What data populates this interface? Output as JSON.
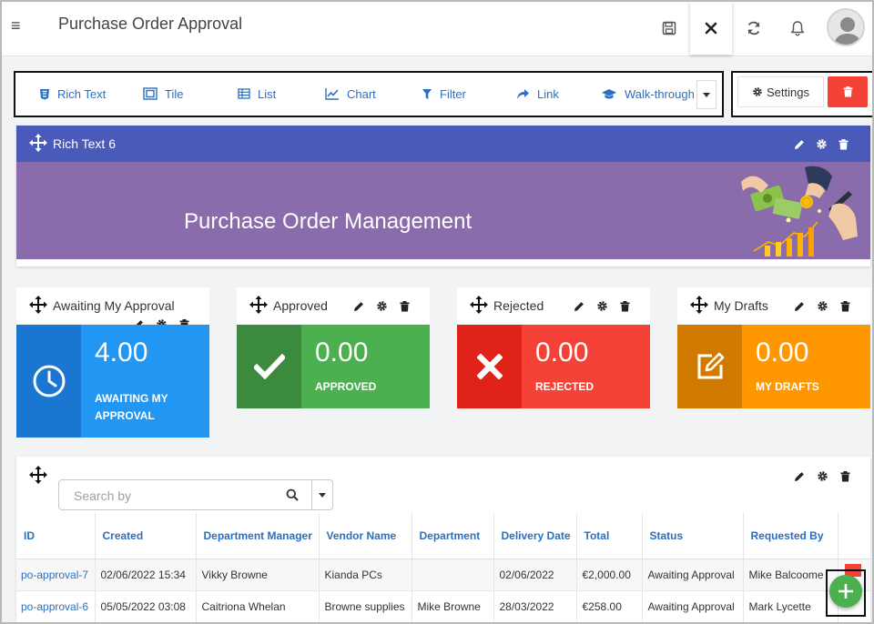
{
  "header": {
    "title": "Purchase Order Approval",
    "icons": [
      "menu-icon",
      "save-icon",
      "close-icon",
      "refresh-icon",
      "bell-icon",
      "user-avatar"
    ]
  },
  "toolbar": {
    "items": [
      {
        "label": "Rich Text",
        "icon": "rich-text-icon"
      },
      {
        "label": "Tile",
        "icon": "tile-icon"
      },
      {
        "label": "List",
        "icon": "list-icon"
      },
      {
        "label": "Chart",
        "icon": "chart-icon"
      },
      {
        "label": "Filter",
        "icon": "filter-icon"
      },
      {
        "label": "Link",
        "icon": "link-icon"
      },
      {
        "label": "Walk-through",
        "icon": "graduation-cap-icon"
      }
    ],
    "settings_label": "Settings"
  },
  "rich_text": {
    "widget_title": "Rich Text 6",
    "heading": "Purchase Order Management"
  },
  "cards": [
    {
      "title": "Awaiting My Approval",
      "value": "4.00",
      "caption_line1": "AWAITING MY",
      "caption_line2": "APPROVAL",
      "color": "#2196f3",
      "icon_bg": "#1b76d2",
      "icon": "clock-icon"
    },
    {
      "title": "Approved",
      "value": "0.00",
      "caption_line1": "APPROVED",
      "caption_line2": "",
      "color": "#4caf50",
      "icon_bg": "#3b8a3e",
      "icon": "check-icon"
    },
    {
      "title": "Rejected",
      "value": "0.00",
      "caption_line1": "REJECTED",
      "caption_line2": "",
      "color": "#f44336",
      "icon_bg": "#e02318",
      "icon": "x-icon"
    },
    {
      "title": "My Drafts",
      "value": "0.00",
      "caption_line1": "MY DRAFTS",
      "caption_line2": "",
      "color": "#ff9800",
      "icon_bg": "#d17a00",
      "icon": "edit-icon"
    }
  ],
  "table": {
    "search_placeholder": "Search by",
    "columns": [
      "ID",
      "Created",
      "Department Manager",
      "Vendor Name",
      "Department",
      "Delivery Date",
      "Total",
      "Status",
      "Requested By"
    ],
    "rows": [
      [
        "po-approval-7",
        "02/06/2022 15:34",
        "Vikky Browne",
        "Kianda PCs",
        "",
        "02/06/2022",
        "€2,000.00",
        "Awaiting Approval",
        "Mike Balcoome"
      ],
      [
        "po-approval-6",
        "05/05/2022 03:08",
        "Caitriona Whelan",
        "Browne supplies",
        "Mike Browne",
        "28/03/2022",
        "€258.00",
        "Awaiting Approval",
        "Mark Lycette"
      ]
    ]
  },
  "colors": {
    "accent_blue": "#2b6fc2",
    "rich_text_header": "#4a5ab9",
    "banner": "#8a6bab",
    "delete_red": "#f44336",
    "fab_green": "#4caf50"
  }
}
